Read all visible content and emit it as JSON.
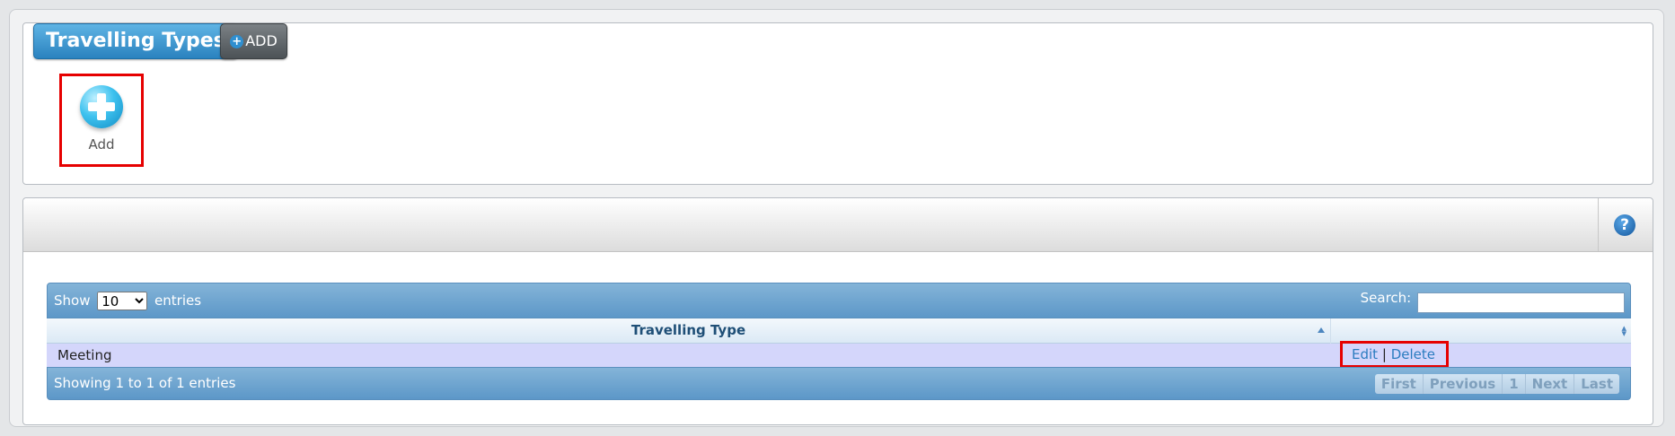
{
  "header": {
    "title": "Travelling Types",
    "add_button_label": "ADD"
  },
  "add_tile": {
    "label": "Add"
  },
  "table": {
    "show_label": "Show",
    "entries_label": "entries",
    "page_length": "10",
    "page_length_options": [
      "10",
      "25",
      "50",
      "100"
    ],
    "search_label": "Search:",
    "search_value": "",
    "columns": [
      "Travelling Type",
      ""
    ],
    "rows": [
      {
        "type": "Meeting",
        "edit": "Edit",
        "separator": "|",
        "delete": "Delete"
      }
    ],
    "info": "Showing 1 to 1 of 1 entries",
    "pagination": {
      "first": "First",
      "previous": "Previous",
      "page": "1",
      "next": "Next",
      "last": "Last"
    }
  },
  "help_icon": {
    "glyph": "?"
  },
  "colors": {
    "accent_blue": "#2a82bf",
    "highlight_red": "#e60000",
    "row_bg": "#d4d6fb"
  }
}
